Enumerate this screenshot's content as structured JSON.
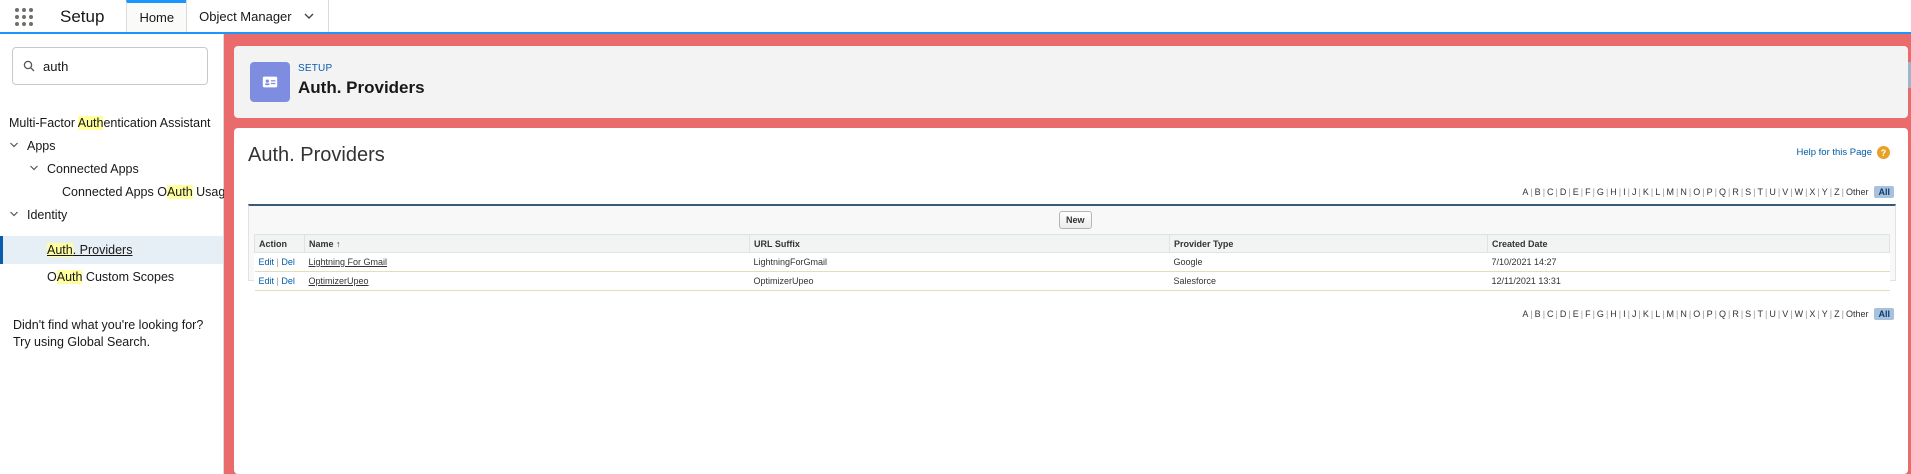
{
  "topbar": {
    "app_name": "Setup",
    "tabs": [
      {
        "label": "Home",
        "active": true
      },
      {
        "label": "Object Manager",
        "active": false
      }
    ]
  },
  "sidebar": {
    "search_value": "auth",
    "items": [
      {
        "pre": "Multi-Factor ",
        "hl": "Auth",
        "post": "entication Assistant"
      },
      {
        "pre": "Apps",
        "hl": "",
        "post": ""
      },
      {
        "pre": "Connected Apps",
        "hl": "",
        "post": ""
      },
      {
        "pre": "Connected Apps O",
        "hl": "Auth",
        "post": " Usage"
      },
      {
        "pre": "Identity",
        "hl": "",
        "post": ""
      },
      {
        "pre": "",
        "hl": "Auth",
        "post": ". Providers"
      },
      {
        "pre": "O",
        "hl": "Auth",
        "post": " Custom Scopes"
      }
    ],
    "help_line1": "Didn't find what you're looking for?",
    "help_line2": "Try using Global Search."
  },
  "header": {
    "eyebrow": "SETUP",
    "title": "Auth. Providers",
    "icon": "identity-card-icon"
  },
  "main": {
    "title": "Auth. Providers",
    "help_link": "Help for this Page",
    "alpha": [
      "A",
      "B",
      "C",
      "D",
      "E",
      "F",
      "G",
      "H",
      "I",
      "J",
      "K",
      "L",
      "M",
      "N",
      "O",
      "P",
      "Q",
      "R",
      "S",
      "T",
      "U",
      "V",
      "W",
      "X",
      "Y",
      "Z",
      "Other",
      "All"
    ],
    "new_button": "New",
    "columns": [
      "Action",
      "Name ↑",
      "URL Suffix",
      "Provider Type",
      "Created Date"
    ],
    "rows": [
      {
        "edit": "Edit",
        "sep": "|",
        "del": "Del",
        "name": "Lightning For Gmail",
        "suffix": "LightningForGmail",
        "type": "Google",
        "created": "7/10/2021 14:27"
      },
      {
        "edit": "Edit",
        "sep": "|",
        "del": "Del",
        "name": "OptimizerUpeo",
        "suffix": "OptimizerUpeo",
        "type": "Salesforce",
        "created": "12/11/2021 13:31"
      }
    ]
  },
  "colors": {
    "background": "#ea6b6b",
    "accent": "#1b96ff",
    "header_icon": "#7f8de1",
    "highlight": "#ffff9e"
  }
}
